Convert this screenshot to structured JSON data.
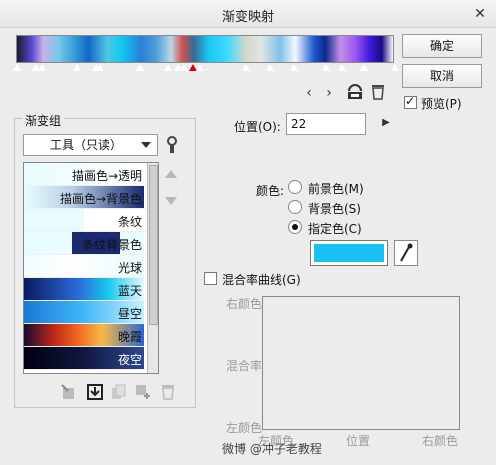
{
  "window": {
    "title": "渐变映射",
    "close_icon": "close-icon"
  },
  "buttons": {
    "ok": "确定",
    "cancel": "取消"
  },
  "preview": {
    "label": "预览(P)",
    "checked": true
  },
  "gradient_group": {
    "label": "渐变组",
    "select_value": "工具（只读）",
    "items": [
      {
        "label": "描画色→透明"
      },
      {
        "label": "描画色→背景色"
      },
      {
        "label": "条纹"
      },
      {
        "label": "条纹背景色"
      },
      {
        "label": "光球"
      },
      {
        "label": "蓝天"
      },
      {
        "label": "昼空"
      },
      {
        "label": "晚霞"
      },
      {
        "label": "夜空"
      }
    ]
  },
  "position": {
    "label": "位置(O):",
    "value": "22"
  },
  "color": {
    "label": "颜色:",
    "options": [
      "前景色(M)",
      "背景色(S)",
      "指定色(C)"
    ],
    "selected_index": 2,
    "swatch": "#18c0f4"
  },
  "curve": {
    "label": "混合率曲线(G)",
    "checked": false,
    "right_color": "右颜色",
    "mix_rate": "混合率",
    "left_color": "左颜色",
    "left_color_axis": "左颜色",
    "position_axis": "位置",
    "right_color_axis": "右颜色"
  },
  "watermark": "微博 @冲子老教程",
  "accent": "#18c0f4"
}
